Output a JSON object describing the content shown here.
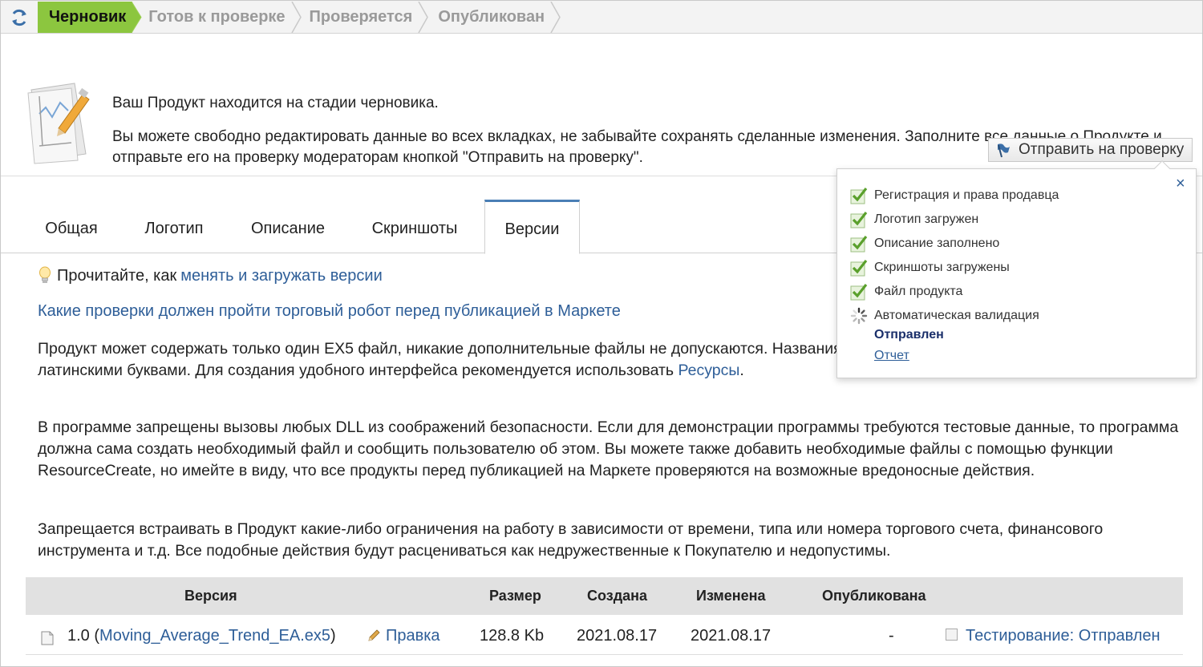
{
  "statusbar": {
    "steps": [
      {
        "label": "Черновик",
        "active": true
      },
      {
        "label": "Готов к проверке",
        "active": false
      },
      {
        "label": "Проверяется",
        "active": false
      },
      {
        "label": "Опубликован",
        "active": false
      }
    ]
  },
  "info": {
    "title": "Ваш Продукт находится на стадии черновика.",
    "description": "Вы можете свободно редактировать данные во всех вкладках, не забывайте сохранять сделанные изменения. Заполните все данные о Продукте и отправьте его на проверку модераторам кнопкой \"Отправить на проверку\".",
    "send_button": "Отправить на проверку"
  },
  "tabs": [
    {
      "label": "Общая"
    },
    {
      "label": "Логотип"
    },
    {
      "label": "Описание"
    },
    {
      "label": "Скриншоты"
    },
    {
      "label": "Версии",
      "active": true
    }
  ],
  "content": {
    "hint_prefix": "Прочитайте, как ",
    "hint_link": "менять и загружать версии",
    "checks_link": "Какие проверки должен пройти торговый робот перед публикацией в Маркете",
    "p1_text": "Продукт может содержать только один EX5 файл, никакие дополнительные файлы не допускаются. Названия входных параметров должны быть написаны латинскими буквами. Для создания удобного интерфейса рекомендуется использовать ",
    "p1_link": "Ресурсы",
    "p1_end": ".",
    "p2": "В программе запрещены вызовы любых DLL из соображений безопасности. Если для демонстрации программы требуются тестовые данные, то программа должна сама создать необходимый файл и сообщить пользователю об этом. Вы можете также добавить необходимые файлы с помощью функции ResourceCreate, но имейте в виду, что все продукты перед публикацией на Маркете проверяются на возможные вредоносные действия.",
    "p3": "Запрещается встраивать в Продукт какие-либо ограничения на работу в зависимости от времени, типа или номера торгового счета, финансового инструмента и т.д. Все подобные действия будут расцениваться как недружественные к Покупателю и недопустимы."
  },
  "table": {
    "headers": {
      "version": "Версия",
      "size": "Размер",
      "created": "Создана",
      "modified": "Изменена",
      "published": "Опубликована"
    },
    "rows": [
      {
        "version": "1.0",
        "file": "Moving_Average_Trend_EA.ex5",
        "edit": "Правка",
        "size": "128.8 Kb",
        "created": "2021.08.17",
        "modified": "2021.08.17",
        "published": "-",
        "testing": "Тестирование: Отправлен"
      }
    ]
  },
  "popup": {
    "items": [
      {
        "label": "Регистрация и права продавца",
        "state": "done"
      },
      {
        "label": "Логотип загружен",
        "state": "done"
      },
      {
        "label": "Описание заполнено",
        "state": "done"
      },
      {
        "label": "Скриншоты загружены",
        "state": "done"
      },
      {
        "label": "Файл продукта",
        "state": "done"
      },
      {
        "label": "Автоматическая валидация",
        "state": "loading"
      }
    ],
    "status": "Отправлен",
    "report": "Отчет",
    "close": "×"
  },
  "colors": {
    "active_step": "#8cc63f",
    "link": "#2e5e98",
    "tab_accent": "#4a7fb5",
    "check_green": "#5aa02c"
  }
}
